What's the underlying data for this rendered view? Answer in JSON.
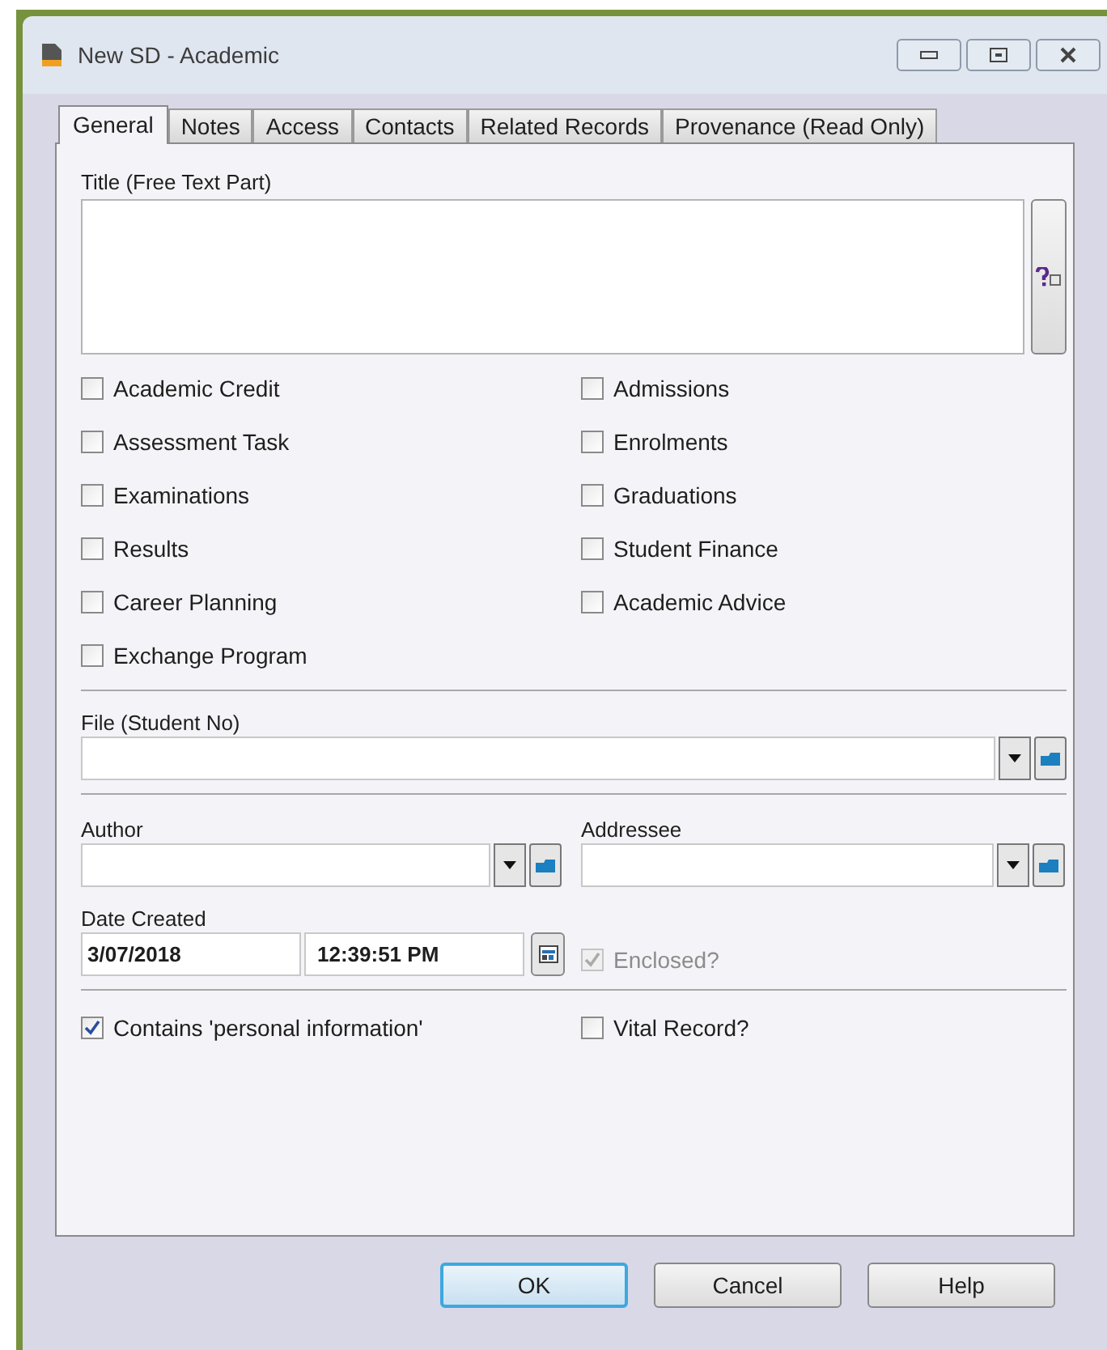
{
  "window": {
    "title": "New SD - Academic"
  },
  "tabs": [
    {
      "label": "General",
      "selected": true
    },
    {
      "label": "Notes",
      "selected": false
    },
    {
      "label": "Access",
      "selected": false
    },
    {
      "label": "Contacts",
      "selected": false
    },
    {
      "label": "Related Records",
      "selected": false
    },
    {
      "label": "Provenance (Read Only)",
      "selected": false
    }
  ],
  "title_field": {
    "label": "Title (Free Text Part)"
  },
  "categories": [
    {
      "label": "Academic Credit",
      "checked": false
    },
    {
      "label": "Admissions",
      "checked": false
    },
    {
      "label": "Assessment Task",
      "checked": false
    },
    {
      "label": "Enrolments",
      "checked": false
    },
    {
      "label": "Examinations",
      "checked": false
    },
    {
      "label": "Graduations",
      "checked": false
    },
    {
      "label": "Results",
      "checked": false
    },
    {
      "label": "Student Finance",
      "checked": false
    },
    {
      "label": "Career Planning",
      "checked": false
    },
    {
      "label": "Academic Advice",
      "checked": false
    },
    {
      "label": "Exchange Program",
      "checked": false
    }
  ],
  "file_field": {
    "label": "File (Student No)"
  },
  "author_field": {
    "label": "Author"
  },
  "addressee_field": {
    "label": "Addressee"
  },
  "date_created": {
    "label": "Date Created",
    "date": "3/07/2018",
    "time": "12:39:51 PM"
  },
  "enclosed": {
    "label": "Enclosed?",
    "checked": true,
    "disabled": true
  },
  "personal_info": {
    "label": "Contains 'personal information'",
    "checked": true,
    "disabled": false
  },
  "vital_record": {
    "label": "Vital Record?",
    "checked": false,
    "disabled": false
  },
  "buttons": [
    {
      "label": "OK",
      "default": true
    },
    {
      "label": "Cancel",
      "default": false
    },
    {
      "label": "Help",
      "default": false
    }
  ]
}
